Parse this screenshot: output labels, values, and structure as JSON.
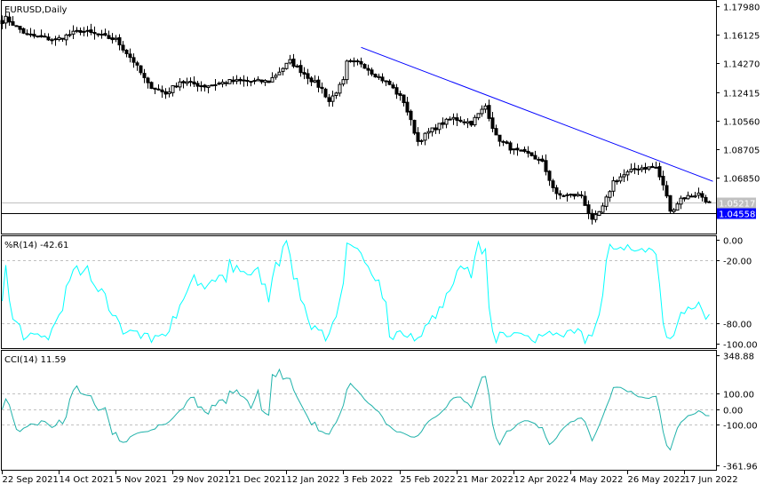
{
  "chart_data": [
    {
      "type": "candlestick",
      "title": "EURUSD,Daily",
      "symbol": "EURUSD",
      "timeframe": "Daily",
      "ylim": [
        1.0385,
        1.181
      ],
      "y_ticks": [
        "1.17980",
        "1.16125",
        "1.14270",
        "1.12415",
        "1.10560",
        "1.08705",
        "1.06850"
      ],
      "bid_label": "1.05217",
      "bid_value": 1.05217,
      "hline_label": "1.04558",
      "hline_value": 1.04558,
      "trendline": {
        "from": [
          101,
          1.1531
        ],
        "to": [
          200,
          1.0661
        ],
        "color": "#0000ff"
      },
      "close_keypoints": [
        [
          0,
          1.17
        ],
        [
          1,
          1.172
        ],
        [
          7,
          1.161
        ],
        [
          15,
          1.158
        ],
        [
          22,
          1.164
        ],
        [
          32,
          1.158
        ],
        [
          37,
          1.144
        ],
        [
          41,
          1.129
        ],
        [
          46,
          1.123
        ],
        [
          50,
          1.131
        ],
        [
          57,
          1.128
        ],
        [
          64,
          1.131
        ],
        [
          75,
          1.131
        ],
        [
          81,
          1.144
        ],
        [
          86,
          1.134
        ],
        [
          90,
          1.126
        ],
        [
          92,
          1.118
        ],
        [
          96,
          1.131
        ],
        [
          97,
          1.143
        ],
        [
          101,
          1.143
        ],
        [
          104,
          1.137
        ],
        [
          109,
          1.129
        ],
        [
          113,
          1.118
        ],
        [
          117,
          1.092
        ],
        [
          120,
          1.098
        ],
        [
          124,
          1.104
        ],
        [
          127,
          1.107
        ],
        [
          132,
          1.104
        ],
        [
          136,
          1.115
        ],
        [
          139,
          1.095
        ],
        [
          144,
          1.086
        ],
        [
          149,
          1.083
        ],
        [
          152,
          1.078
        ],
        [
          156,
          1.057
        ],
        [
          159,
          1.057
        ],
        [
          163,
          1.057
        ],
        [
          166,
          1.04
        ],
        [
          169,
          1.049
        ],
        [
          172,
          1.066
        ],
        [
          174,
          1.069
        ],
        [
          179,
          1.075
        ],
        [
          184,
          1.075
        ],
        [
          187,
          1.057
        ],
        [
          188,
          1.046
        ],
        [
          191,
          1.055
        ],
        [
          196,
          1.058
        ],
        [
          199,
          1.052
        ]
      ],
      "x_labels": [
        "22 Sep 2021",
        "14 Oct 2021",
        "5 Nov 2021",
        "29 Nov 2021",
        "21 Dec 2021",
        "12 Jan 2022",
        "3 Feb 2022",
        "25 Feb 2022",
        "21 Mar 2022",
        "12 Apr 2022",
        "4 May 2022",
        "26 May 2022",
        "17 Jun 2022"
      ],
      "bars_between_labels": 16
    },
    {
      "type": "line",
      "title": "%R(14) -42.61",
      "ylim": [
        -100,
        0
      ],
      "y_ticks": [
        "0.00",
        "-20.00",
        "-80.00",
        "-100.00"
      ],
      "levels": [
        -20,
        -80
      ],
      "color": "#00ffff"
    },
    {
      "type": "line",
      "title": "CCI(14) 11.59",
      "ylim": [
        -361.96,
        348.88
      ],
      "y_ticks": [
        "348.88",
        "100.00",
        "0.00",
        "-100.00",
        "-361.96"
      ],
      "levels": [
        100,
        0,
        -100
      ],
      "color": "#20b2aa"
    }
  ]
}
